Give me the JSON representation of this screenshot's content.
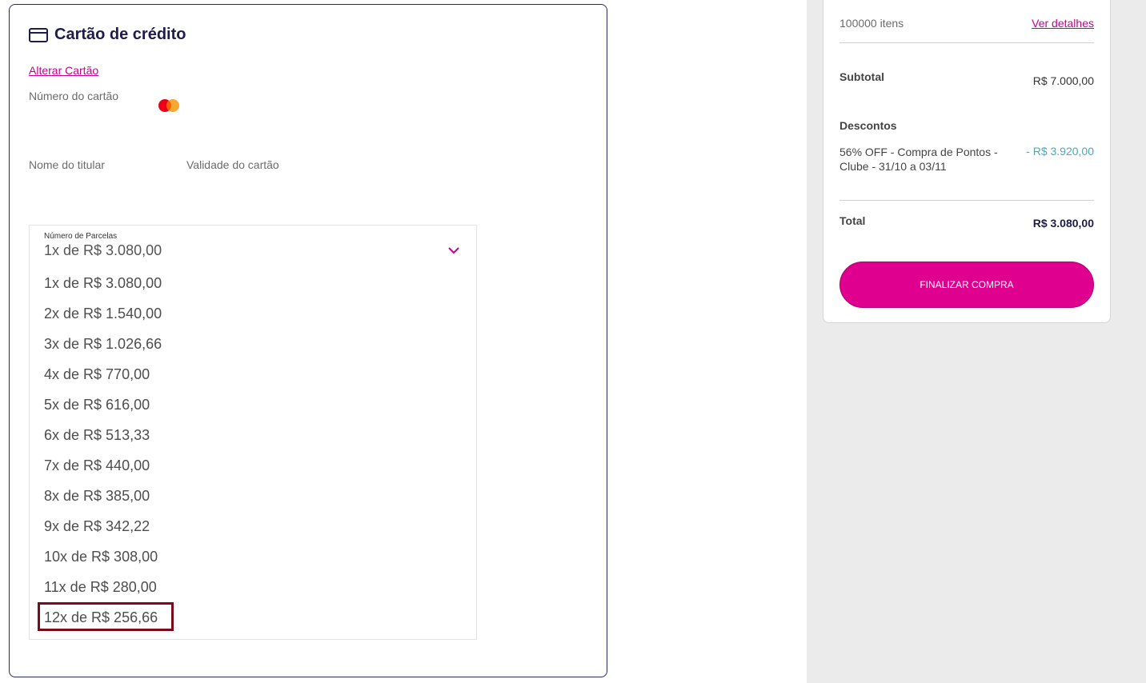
{
  "payment": {
    "title": "Cartão de crédito",
    "change_card": "Alterar Cartão",
    "card_number_label": "Número do cartão",
    "holder_label": "Nome do titular",
    "validity_label": "Validade do cartão"
  },
  "installments": {
    "caption": "Número de Parcelas",
    "selected": "1x de R$ 3.080,00",
    "options": [
      "1x de R$ 3.080,00",
      "2x de R$ 1.540,00",
      "3x de R$ 1.026,66",
      "4x de R$ 770,00",
      "5x de R$ 616,00",
      "6x de R$ 513,33",
      "7x de R$ 440,00",
      "8x de R$ 385,00",
      "9x de R$ 342,22",
      "10x de R$ 308,00",
      "11x de R$ 280,00",
      "12x de R$ 256,66"
    ]
  },
  "summary": {
    "items": "100000 itens",
    "details_link": "Ver detalhes",
    "subtotal_label": "Subtotal",
    "subtotal_value": "R$ 7.000,00",
    "discounts_label": "Descontos",
    "discount_desc": "56% OFF - Compra de Pontos - Clube - 31/10 a 03/11",
    "discount_value": "- R$ 3.920,00",
    "total_label": "Total",
    "total_value": "R$ 3.080,00",
    "finish_button": "FINALIZAR COMPRA"
  },
  "colors": {
    "accent": "#e0008f",
    "link": "#c8008f",
    "title": "#1f1c4d",
    "discount": "#4aa8b8",
    "highlight_border": "#7a0a1e"
  }
}
